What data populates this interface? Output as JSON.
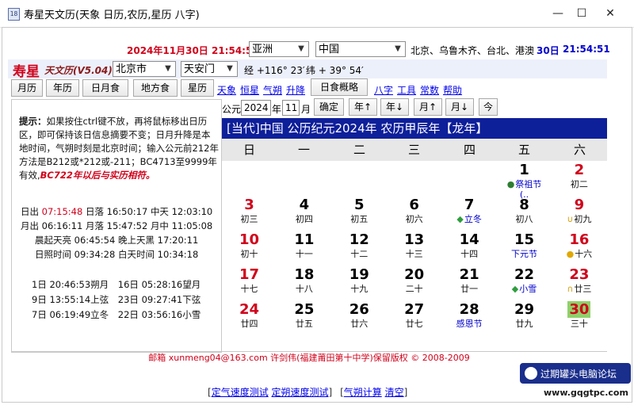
{
  "window": {
    "title": "寿星天文历(天象 日历,农历,星历 八字)",
    "app_icon": "18",
    "controls": {
      "minimize": "—",
      "maximize": "☐",
      "close": "✕"
    }
  },
  "top": {
    "datetime": "2024年11月30日 21:54:51",
    "continent_select": "亚洲",
    "country_select": "中国",
    "cities_label": "北京、乌鲁木齐、台北、港澳",
    "day": "30日",
    "time": "21:54:51"
  },
  "brand": {
    "name": "寿星",
    "version": "天文历(V5.04)",
    "city_select": "北京市",
    "place_select": "天安门",
    "longitude": "经 +116° 23′",
    "latitude": "纬 + 39° 54′"
  },
  "toolbar": {
    "buttons": [
      "月历",
      "年历",
      "日月食",
      "地方食",
      "星历"
    ],
    "links1": [
      "天象",
      "恒星",
      "气朔",
      "升降"
    ],
    "eclipse_button": "日食概略",
    "links2": [
      "八字",
      "工具",
      "常数",
      "帮助"
    ]
  },
  "nav": {
    "era_label": "公元",
    "year_value": "2024",
    "year_label": "年",
    "month_value": "11",
    "month_label": "月",
    "confirm": "确定",
    "year_up": "年↑",
    "year_down": "年↓",
    "month_up": "月↑",
    "month_down": "月↓",
    "today": "今"
  },
  "left": {
    "tip_title": "提示：",
    "tip_body": "如果按住ctrl键不放，再将鼠标移出日历区，即可保持该日信息摘要不变；日月升降是本地时间，气朔时刻是北京时间；输入公元前212年方法是B212或*212或-211；BC4713至9999年有效,",
    "tip_red": "BC722年以后与实历相符。",
    "sunrise_label": "日出",
    "sunrise": "07:15:48",
    "sunset_label": "日落",
    "sunset": "16:50:17",
    "noon_label": "中天",
    "noon": "12:03:10",
    "moonrise_label": "月出",
    "moonrise": "06:16:11",
    "moonset_label": "月落",
    "moonset": "15:47:52",
    "moonnoon_label": "月中",
    "moonnoon": "11:05:08",
    "dawn_label": "晨起天亮",
    "dawn": "06:45:54",
    "dusk_label": "晚上天黑",
    "dusk": "17:20:11",
    "daylight_label": "日照时间",
    "daylight": "09:34:28",
    "daytime_label": "白天时间",
    "daytime": "10:34:18",
    "phases": [
      [
        "1日",
        "20:46:53朔月",
        "16日",
        "05:28:16望月"
      ],
      [
        "9日",
        "13:55:14上弦",
        "23日",
        "09:27:41下弦"
      ],
      [
        "7日",
        "06:19:49立冬",
        "22日",
        "03:56:16小雪"
      ]
    ]
  },
  "calendar": {
    "header": "[当代]中国 公历纪元2024年 农历甲辰年【龙年】",
    "weekdays": [
      "日",
      "一",
      "二",
      "三",
      "四",
      "五",
      "六"
    ],
    "days": [
      {
        "num": "1",
        "lunar": "祭祖节",
        "sub": "(..",
        "color": "#000000",
        "mark": "●",
        "mark_color": "#2e7d32",
        "lunar_color": "#0000cc"
      },
      {
        "num": "2",
        "lunar": "初二",
        "color": "#d0021b"
      },
      {
        "num": "3",
        "lunar": "初三",
        "color": "#d0021b"
      },
      {
        "num": "4",
        "lunar": "初四",
        "color": "#000000"
      },
      {
        "num": "5",
        "lunar": "初五",
        "color": "#000000"
      },
      {
        "num": "6",
        "lunar": "初六",
        "color": "#000000"
      },
      {
        "num": "7",
        "lunar": "立冬",
        "color": "#000000",
        "mark": "◆",
        "mark_color": "#2e9e3e",
        "lunar_color": "#0000cc"
      },
      {
        "num": "8",
        "lunar": "初八",
        "color": "#000000"
      },
      {
        "num": "9",
        "lunar": "初九",
        "color": "#d0021b",
        "mark": "∪",
        "mark_color": "#d4a017"
      },
      {
        "num": "10",
        "lunar": "初十",
        "color": "#d0021b"
      },
      {
        "num": "11",
        "lunar": "十一",
        "color": "#000000"
      },
      {
        "num": "12",
        "lunar": "十二",
        "color": "#000000"
      },
      {
        "num": "13",
        "lunar": "十三",
        "color": "#000000"
      },
      {
        "num": "14",
        "lunar": "十四",
        "color": "#000000"
      },
      {
        "num": "15",
        "lunar": "下元节",
        "color": "#000000",
        "lunar_color": "#0000cc"
      },
      {
        "num": "16",
        "lunar": "十六",
        "color": "#d0021b",
        "mark": "●",
        "mark_color": "#e0a800"
      },
      {
        "num": "17",
        "lunar": "十七",
        "color": "#d0021b"
      },
      {
        "num": "18",
        "lunar": "十八",
        "color": "#000000"
      },
      {
        "num": "19",
        "lunar": "十九",
        "color": "#000000"
      },
      {
        "num": "20",
        "lunar": "二十",
        "color": "#000000"
      },
      {
        "num": "21",
        "lunar": "廿一",
        "color": "#000000"
      },
      {
        "num": "22",
        "lunar": "小雪",
        "color": "#000000",
        "mark": "◆",
        "mark_color": "#2e9e3e",
        "lunar_color": "#0000cc"
      },
      {
        "num": "23",
        "lunar": "廿三",
        "color": "#d0021b",
        "mark": "∩",
        "mark_color": "#d4a017"
      },
      {
        "num": "24",
        "lunar": "廿四",
        "color": "#d0021b"
      },
      {
        "num": "25",
        "lunar": "廿五",
        "color": "#000000"
      },
      {
        "num": "26",
        "lunar": "廿六",
        "color": "#000000"
      },
      {
        "num": "27",
        "lunar": "廿七",
        "color": "#000000"
      },
      {
        "num": "28",
        "lunar": "感恩节",
        "color": "#000000",
        "lunar_color": "#0000cc"
      },
      {
        "num": "29",
        "lunar": "廿九",
        "color": "#000000"
      },
      {
        "num": "30",
        "lunar": "三十",
        "color": "#d0021b",
        "today": true
      }
    ],
    "first_weekday": 5,
    "today_bg": "#8fd16a"
  },
  "footer": {
    "text": "邮箱 xunmeng04@163.com 许剑伟(福建莆田第十中学)保留版权 © 2008-2009"
  },
  "bottom_links": [
    "定气速度测试",
    "定朔速度测试",
    "气朔计算",
    "清空"
  ],
  "watermark": {
    "line1": "过期罐头电脑论坛",
    "line2": "www.gqgtpc.com"
  },
  "colors": {
    "header_blue": "#0e1f9a",
    "accent_red": "#d0021b",
    "link_blue": "#0000ee"
  }
}
